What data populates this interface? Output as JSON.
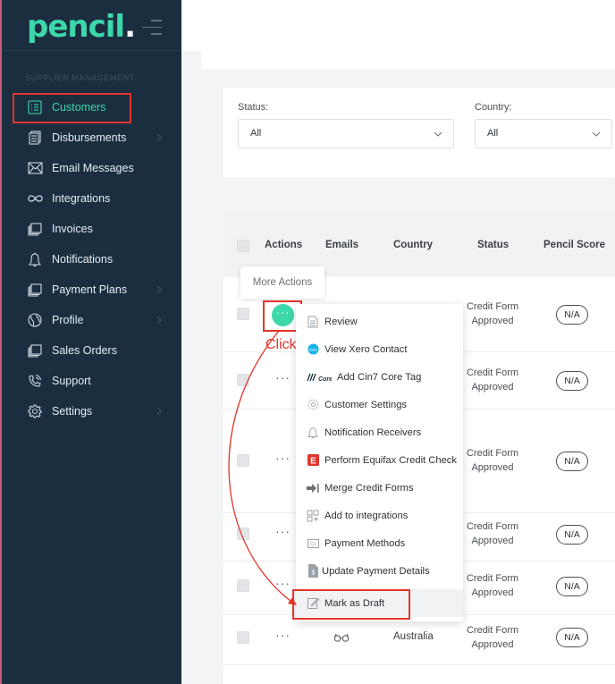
{
  "app": {
    "logo": "pencil",
    "logo_dot": "."
  },
  "sidebar": {
    "section": "SUPPLIER MANAGEMENT",
    "items": [
      {
        "label": "Customers",
        "icon": "list-icon",
        "active": true,
        "chevron": false
      },
      {
        "label": "Disbursements",
        "icon": "stack-icon",
        "active": false,
        "chevron": true
      },
      {
        "label": "Email Messages",
        "icon": "envelope-icon",
        "active": false,
        "chevron": false
      },
      {
        "label": "Integrations",
        "icon": "infinity-icon",
        "active": false,
        "chevron": false
      },
      {
        "label": "Invoices",
        "icon": "copy-icon",
        "active": false,
        "chevron": false
      },
      {
        "label": "Notifications",
        "icon": "bell-icon",
        "active": false,
        "chevron": false
      },
      {
        "label": "Payment Plans",
        "icon": "copy-icon",
        "active": false,
        "chevron": true
      },
      {
        "label": "Profile",
        "icon": "globe-icon",
        "active": false,
        "chevron": true
      },
      {
        "label": "Sales Orders",
        "icon": "copy-icon",
        "active": false,
        "chevron": false
      },
      {
        "label": "Support",
        "icon": "phone-icon",
        "active": false,
        "chevron": false
      },
      {
        "label": "Settings",
        "icon": "gear-icon",
        "active": false,
        "chevron": true
      }
    ]
  },
  "filters": {
    "status_label": "Status:",
    "status_value": "All",
    "country_label": "Country:",
    "country_value": "All"
  },
  "table": {
    "headers": {
      "actions": "Actions",
      "emails": "Emails",
      "country": "Country",
      "status": "Status",
      "pencil_score": "Pencil Score"
    },
    "rows": [
      {
        "status_line1": "Credit Form",
        "status_line2": "Approved",
        "score": "N/A",
        "country": ""
      },
      {
        "status_line1": "Credit Form",
        "status_line2": "Approved",
        "score": "N/A",
        "country": ""
      },
      {
        "status_line1": "Credit Form",
        "status_line2": "Approved",
        "score": "N/A",
        "country": ""
      },
      {
        "status_line1": "Credit Form",
        "status_line2": "Approved",
        "score": "N/A",
        "country": ""
      },
      {
        "status_line1": "Credit Form",
        "status_line2": "Approved",
        "score": "N/A",
        "country": ""
      },
      {
        "status_line1": "Credit Form",
        "status_line2": "Approved",
        "score": "N/A",
        "country": "Australia"
      }
    ]
  },
  "tooltip": "More Actions",
  "annotation": {
    "click": "Click"
  },
  "menu": {
    "items": [
      {
        "label": "Review",
        "icon": "document-icon"
      },
      {
        "label": "View Xero Contact",
        "icon": "xero-icon"
      },
      {
        "label": "Add Cin7 Core Tag",
        "icon": "cin7-icon"
      },
      {
        "label": "Customer Settings",
        "icon": "gear-icon"
      },
      {
        "label": "Notification Receivers",
        "icon": "bell-icon"
      },
      {
        "label": "Perform Equifax Credit Check",
        "icon": "equifax-icon"
      },
      {
        "label": "Merge Credit Forms",
        "icon": "merge-icon"
      },
      {
        "label": "Add to integrations",
        "icon": "grid-add-icon"
      },
      {
        "label": "Payment Methods",
        "icon": "card-icon"
      },
      {
        "label": "Update Payment Details",
        "icon": "dollar-document-icon"
      },
      {
        "label": "Mark as Draft",
        "icon": "edit-icon"
      }
    ]
  },
  "colors": {
    "accent": "#3dd8aa",
    "sidebar": "#1a2e40",
    "annotation": "#e2352a"
  }
}
